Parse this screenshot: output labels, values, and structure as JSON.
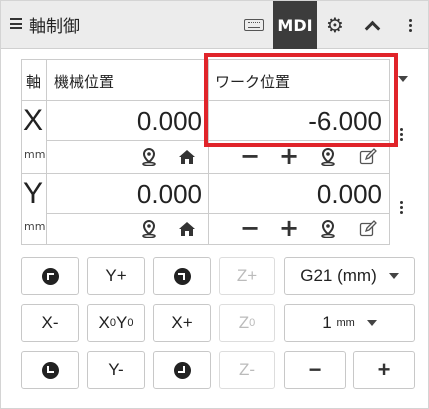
{
  "header": {
    "title": "軸制御",
    "mdi_label": "MDI",
    "icons": [
      "menu-icon",
      "keyboard-icon",
      "gear-icon",
      "chevron-up-icon",
      "more-vert-icon"
    ]
  },
  "table": {
    "col_axis": "軸",
    "col_machine": "機械位置",
    "col_work": "ワーク位置",
    "rows": [
      {
        "axis": "X",
        "unit": "mm",
        "machine": "0.000",
        "work": "-6.000"
      },
      {
        "axis": "Y",
        "unit": "mm",
        "machine": "0.000",
        "work": "0.000"
      }
    ]
  },
  "jog": {
    "y_plus": "Y+",
    "z_plus": "Z+",
    "x_minus": "X-",
    "x0y0_x": "X",
    "x0y0_x_sub": "0",
    "x0y0_y": "Y",
    "x0y0_y_sub": "0",
    "x_plus": "X+",
    "z0": "Z",
    "z0_sub": "0",
    "y_minus": "Y-",
    "z_minus": "Z-",
    "units_select": "G21 (mm)",
    "step_value": "1",
    "step_unit": "mm",
    "minus": "−",
    "plus": "+"
  },
  "colors": {
    "highlight": "#e0242a",
    "header_bg": "#ececec",
    "active_tab": "#3c3c3c"
  }
}
